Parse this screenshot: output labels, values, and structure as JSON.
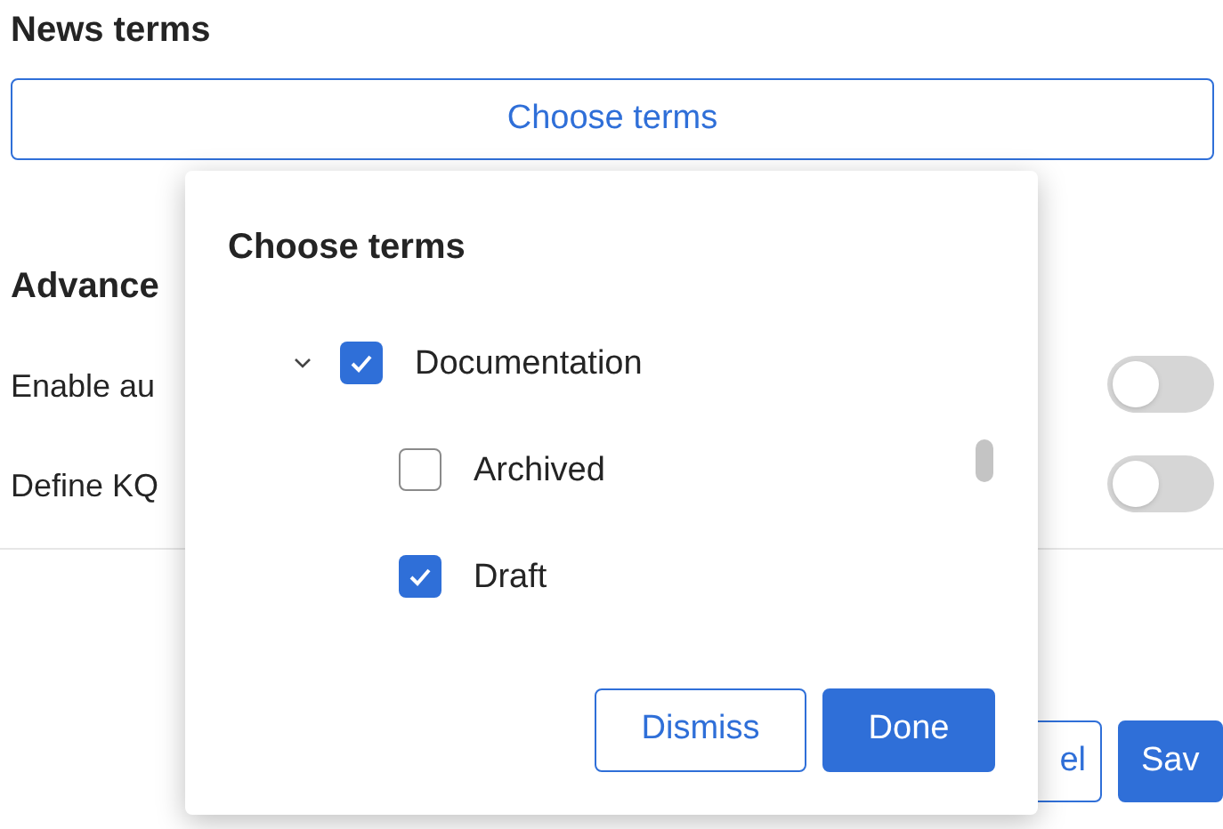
{
  "section_title": "News terms",
  "choose_button": "Choose terms",
  "advanced_title": "Advance",
  "settings": [
    {
      "label": "Enable au",
      "on": false
    },
    {
      "label": "Define KQ",
      "on": false
    }
  ],
  "footer_buttons": [
    {
      "label": "el",
      "kind": "secondary"
    },
    {
      "label": "Sav",
      "kind": "primary"
    }
  ],
  "dialog": {
    "title": "Choose terms",
    "tree": [
      {
        "label": "Documentation",
        "expanded": true,
        "checked": true,
        "children": [
          {
            "label": "Archived",
            "checked": false
          },
          {
            "label": "Draft",
            "checked": true
          }
        ]
      }
    ],
    "buttons": [
      {
        "label": "Dismiss",
        "kind": "secondary"
      },
      {
        "label": "Done",
        "kind": "primary"
      }
    ]
  }
}
